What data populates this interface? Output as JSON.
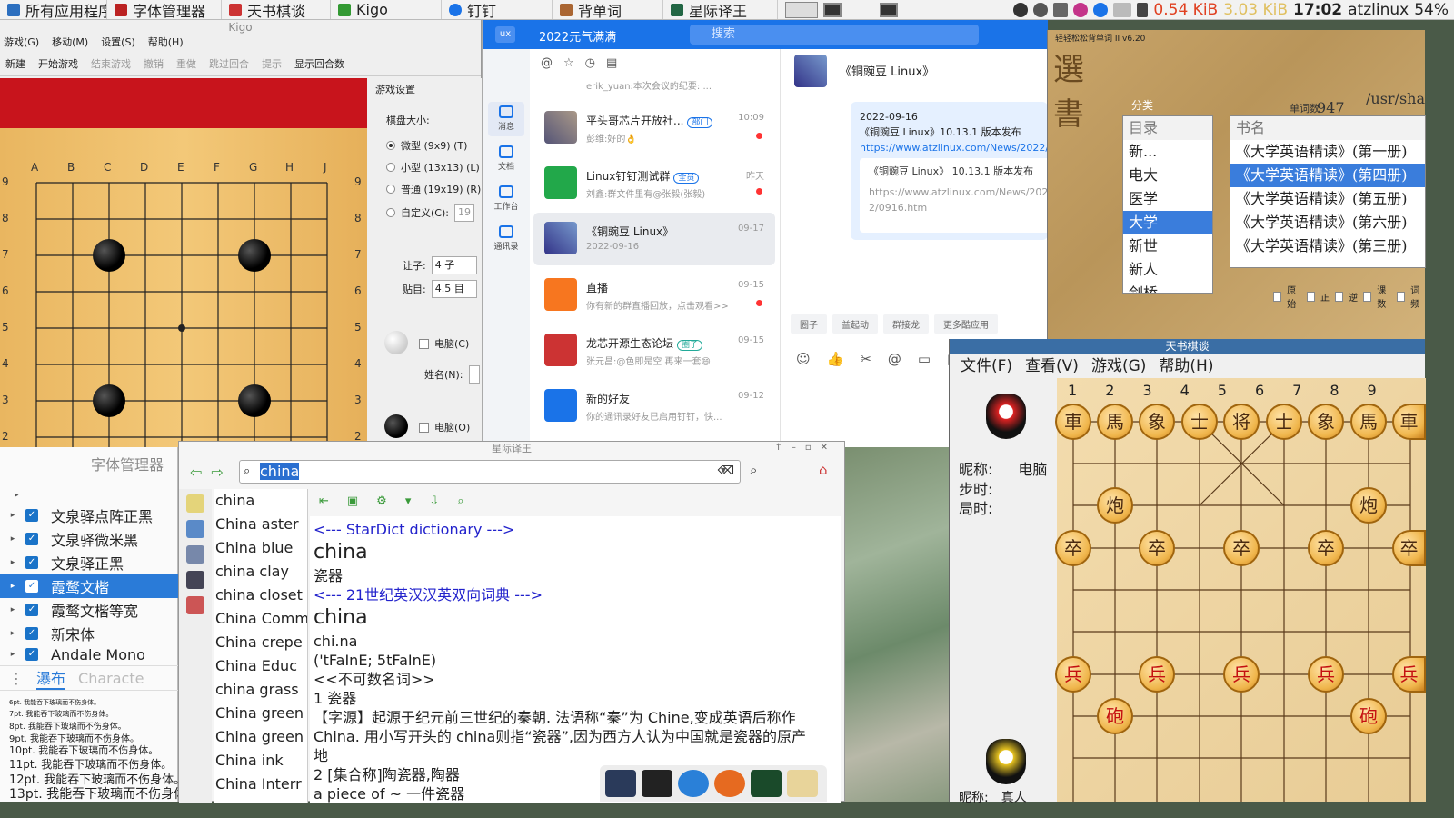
{
  "taskbar": {
    "items": [
      "所有应用程序",
      "字体管理器",
      "天书棋谈",
      "Kigo",
      "钉钉",
      "背单词",
      "星际译王"
    ],
    "tray_net_down": "0.54 KiB",
    "tray_net_up": "3.03 KiB",
    "clock": "17:02",
    "user": "atzlinux",
    "battery": "54%"
  },
  "kigo": {
    "title": "Kigo",
    "menu": [
      "游戏(G)",
      "移动(M)",
      "设置(S)",
      "帮助(H)"
    ],
    "toolbar": [
      "新建",
      "开始游戏",
      "结束游戏",
      "撤销",
      "重做",
      "跳过回合",
      "提示",
      "显示回合数"
    ],
    "columns": [
      "A",
      "B",
      "C",
      "D",
      "E",
      "F",
      "G",
      "H",
      "J"
    ],
    "rows": [
      "9",
      "8",
      "7",
      "6",
      "5",
      "4",
      "3",
      "2"
    ],
    "settings_title": "游戏设置",
    "board_size_label": "棋盘大小:",
    "sizes": [
      "微型 (9x9) (T)",
      "小型 (13x13) (L)",
      "普通 (19x19) (R)",
      "自定义(C):"
    ],
    "custom_value": "19",
    "handicap_label": "让子:",
    "handicap_value": "4 子",
    "komi_label": "贴目:",
    "komi_value": "4.5 目",
    "computer_label": "电脑(C)",
    "name_label": "姓名(N):",
    "computer_label2": "电脑(O)"
  },
  "ding": {
    "logo": "ux",
    "status": "2022元气满满",
    "search_placeholder": "搜索",
    "side": [
      "消息",
      "文档",
      "工作台",
      "通讯录"
    ],
    "chats": [
      {
        "name": "erik_yuan:本次会议的纪要: ...",
        "sub": "",
        "time": ""
      },
      {
        "name": "平头哥芯片开放社...",
        "badge": "部门",
        "sub": "彭维:好的👌",
        "time": "10:09"
      },
      {
        "name": "Linux钉钉测试群",
        "badge": "全员",
        "sub": "刘鑫:群文件里有@张毅(张毅)",
        "time": "昨天"
      },
      {
        "name": "《铜豌豆 Linux》",
        "sub": "2022-09-16",
        "time": "09-17"
      },
      {
        "name": "直播",
        "sub": "你有新的群直播回放，点击观看>>",
        "time": "09-15"
      },
      {
        "name": "龙芯开源生态论坛",
        "badge": "圈子",
        "sub": "张元昌:@色即是空 再来一套😄",
        "time": "09-15"
      },
      {
        "name": "新的好友",
        "sub": "你的通讯录好友已启用钉钉，快...",
        "time": "09-12"
      }
    ],
    "conv_title": "《铜豌豆 Linux》",
    "msg_date": "2022-09-16",
    "msg_text": "《铜豌豆 Linux》10.13.1 版本发布",
    "msg_link": "https://www.atzlinux.com/News/2022/",
    "card_title": "《铜豌豆 Linux》 10.13.1 版本发布",
    "card_url": "https://www.atzlinux.com/News/2022/0916.htm",
    "quick": [
      "圈子",
      "益起动",
      "群接龙",
      "更多酷应用"
    ]
  },
  "words": {
    "header": "轻轻松松背单词 II v6.20",
    "cat_label": "分类",
    "count_label": "单词数",
    "count_value": "947",
    "path_label": "/usr/sha",
    "dir_label": "目录",
    "book_label": "书名",
    "dirs": [
      "新...",
      "电大",
      "医学",
      "大学",
      "新世",
      "新人",
      "剑桥"
    ],
    "books": [
      "《大学英语精读》(第一册)",
      "《大学英语精读》(第四册)",
      "《大学英语精读》(第五册)",
      "《大学英语精读》(第六册)",
      "《大学英语精读》(第三册)"
    ],
    "options": [
      "原始",
      "正",
      "逆",
      "课数",
      "词频"
    ]
  },
  "xq": {
    "title": "天书棋谈",
    "menu": [
      "文件(F)",
      "查看(V)",
      "游戏(G)",
      "帮助(H)"
    ],
    "cols": [
      "1",
      "2",
      "3",
      "4",
      "5",
      "6",
      "7",
      "8",
      "9"
    ],
    "nick_label": "昵称:",
    "nick_value": "电脑",
    "steps_label": "步时:",
    "time_label": "局时:",
    "nick_label2": "昵称:",
    "nick_value2": "真人",
    "pieces": {
      "black_back": [
        "車",
        "馬",
        "象",
        "士",
        "将",
        "士",
        "象",
        "馬",
        "車"
      ],
      "black_cannon": "炮",
      "black_pawn": "卒",
      "red_pawn": "兵",
      "red_cannon": "砲"
    }
  },
  "fm": {
    "title": "字体管理器",
    "fonts": [
      "文泉驿点阵正黑",
      "文泉驿微米黑",
      "文泉驿正黑",
      "霞鹜文楷",
      "霞鹜文楷等宽",
      "新宋体",
      "Andale Mono"
    ],
    "tabs": [
      "瀑布",
      "Characte"
    ],
    "sizes": [
      "6pt.",
      "7pt.",
      "8pt.",
      "9pt.",
      "10pt.",
      "11pt.",
      "12pt.",
      "13pt."
    ],
    "sample": "我能吞下玻璃而不伤身体。"
  },
  "sd": {
    "title": "星际译王",
    "query": "china",
    "words": [
      "china",
      "China aster",
      "China blue",
      "china clay",
      "china closet",
      "China Comm",
      "China crepe",
      "China Educ",
      "china grass",
      "China green",
      "China green",
      "China ink",
      "China Interr"
    ],
    "dict1": "<--- StarDict dictionary --->",
    "head1": "china",
    "def1": "瓷器",
    "dict2": "<--- 21世纪英汉汉英双向词典 --->",
    "head2": "china",
    "syll": "chi.na",
    "phon": "('tFaInE; 5tFaInE)",
    "gram": "<<不可数名词>>",
    "d1": "1 瓷器",
    "d2": "【字源】起源于纪元前三世纪的秦朝. 法语称“秦”为 Chine,变成英语后称作",
    "d3": "China. 用小写开头的 china则指“瓷器”,因为西方人认为中国就是瓷器的原产",
    "d4": "地",
    "d5": "2 [集合称]陶瓷器,陶器",
    "d6": "a piece of ~ 一件瓷器"
  }
}
